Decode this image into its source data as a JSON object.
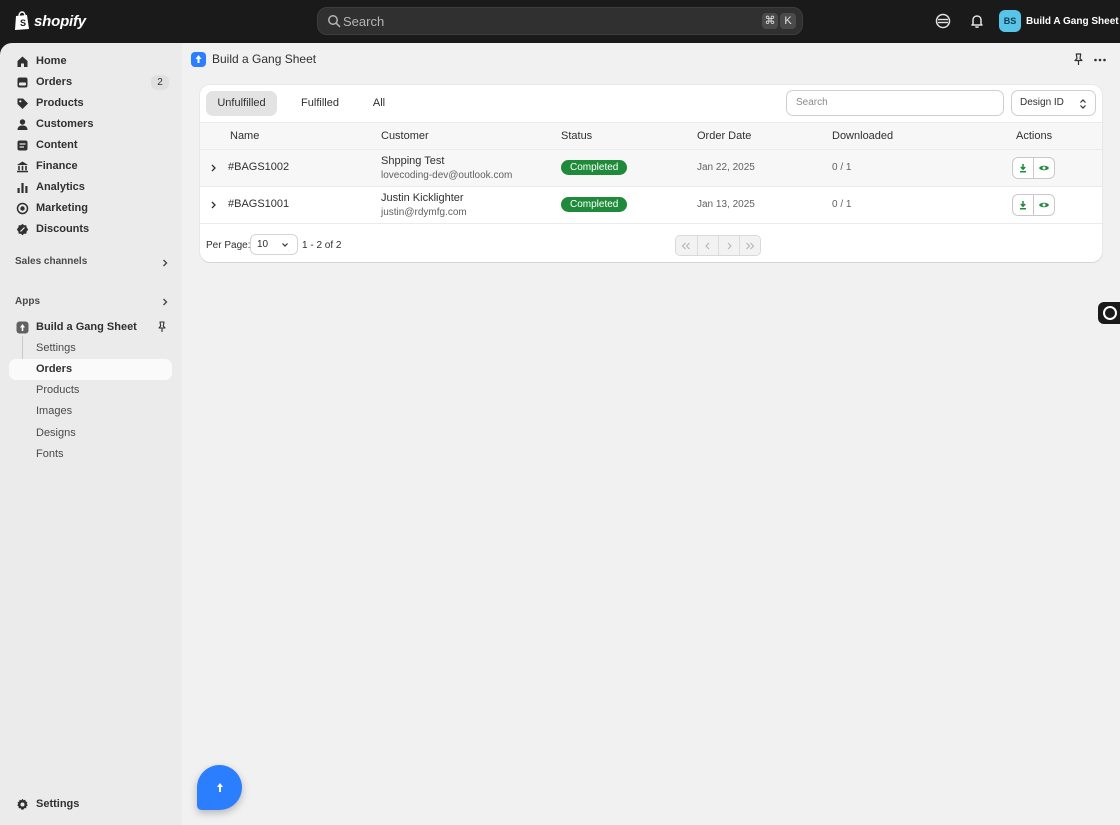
{
  "topbar": {
    "brand": "shopify",
    "search_placeholder": "Search",
    "shortcut_cmd": "⌘",
    "shortcut_key": "K",
    "user_initials": "BS",
    "user_name": "Build A Gang Sheet"
  },
  "sidebar": {
    "items": [
      {
        "label": "Home",
        "icon": "home-icon"
      },
      {
        "label": "Orders",
        "icon": "orders-icon",
        "badge": "2"
      },
      {
        "label": "Products",
        "icon": "tag-icon"
      },
      {
        "label": "Customers",
        "icon": "person-icon"
      },
      {
        "label": "Content",
        "icon": "content-icon"
      },
      {
        "label": "Finance",
        "icon": "bank-icon"
      },
      {
        "label": "Analytics",
        "icon": "bar-chart-icon"
      },
      {
        "label": "Marketing",
        "icon": "target-icon"
      },
      {
        "label": "Discounts",
        "icon": "discount-icon"
      }
    ],
    "sales_channels": "Sales channels",
    "apps": "Apps",
    "app_name": "Build a Gang Sheet",
    "app_sub_items": [
      {
        "label": "Settings",
        "active": false
      },
      {
        "label": "Orders",
        "active": true
      },
      {
        "label": "Products",
        "active": false
      },
      {
        "label": "Images",
        "active": false
      },
      {
        "label": "Designs",
        "active": false
      },
      {
        "label": "Fonts",
        "active": false
      }
    ],
    "settings": "Settings"
  },
  "main": {
    "title": "Build a Gang Sheet",
    "tabs": [
      {
        "label": "Unfulfilled",
        "active": true
      },
      {
        "label": "Fulfilled",
        "active": false
      },
      {
        "label": "All",
        "active": false
      }
    ],
    "search_placeholder": "Search",
    "filter_select": "Design ID",
    "columns": [
      "Name",
      "Customer",
      "Status",
      "Order Date",
      "Downloaded",
      "Actions"
    ],
    "rows": [
      {
        "name": "#BAGS1002",
        "customer": "Shpping Test",
        "email": "lovecoding-dev@outlook.com",
        "status": "Completed",
        "date": "Jan 22, 2025",
        "downloaded": "0 / 1"
      },
      {
        "name": "#BAGS1001",
        "customer": "Justin Kicklighter",
        "email": "justin@rdymfg.com",
        "status": "Completed",
        "date": "Jan 13, 2025",
        "downloaded": "0 / 1"
      }
    ],
    "per_page_label": "Per Page:",
    "per_page_value": "10",
    "range_text": "1 - 2 of 2"
  },
  "colors": {
    "status_completed": "#1f8a3a",
    "app_accent": "#2b7fff",
    "topbar": "#1a1a1a"
  }
}
